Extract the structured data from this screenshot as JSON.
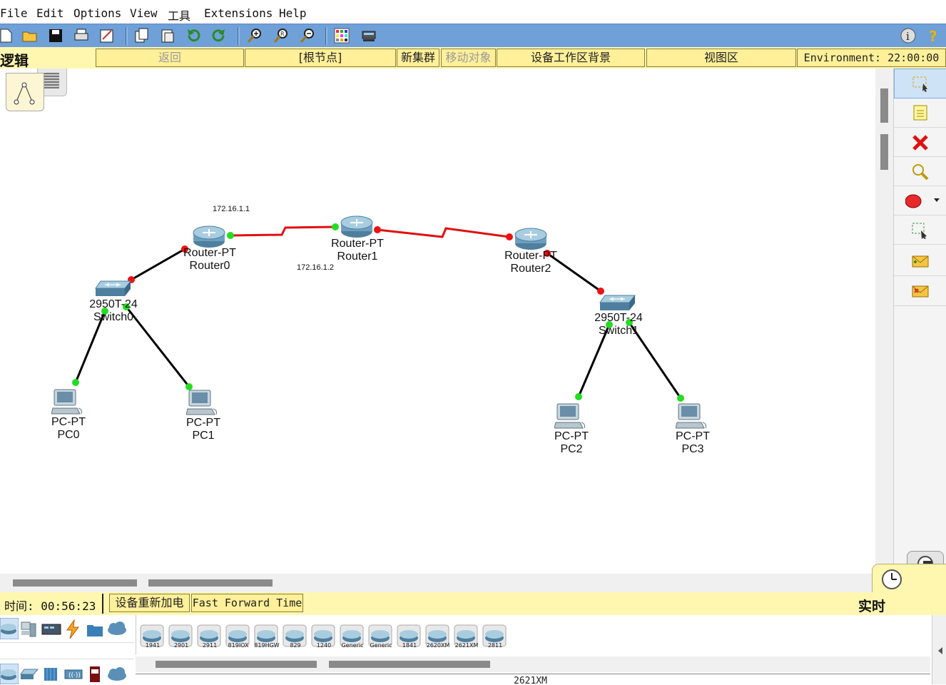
{
  "menu": [
    "File",
    "Edit",
    "Options",
    "View",
    "工具",
    "Extensions",
    "Help"
  ],
  "toolbar": {
    "icons": [
      "new-file-icon",
      "open-folder-icon",
      "save-icon",
      "print-icon",
      "activity-wizard-icon",
      "copy-icon",
      "paste-icon",
      "undo-icon",
      "redo-icon",
      "zoom-in-icon",
      "zoom-reset-icon",
      "zoom-out-icon",
      "palette-icon",
      "custom-device-icon",
      "info-icon",
      "help-icon"
    ]
  },
  "workspace_bar": {
    "mode_label": "逻辑",
    "back": "返回",
    "root": "[根节点]",
    "new_cluster": "新集群",
    "move_object": "移动对象",
    "background": "设备工作区背景",
    "viewport": "视图区",
    "environment": "Environment: 22:00:00"
  },
  "network": {
    "devices": [
      {
        "id": "router0",
        "type": "Router-PT",
        "name": "Router0"
      },
      {
        "id": "router1",
        "type": "Router-PT",
        "name": "Router1"
      },
      {
        "id": "router2",
        "type": "Router-PT",
        "name": "Router2"
      },
      {
        "id": "switch0",
        "type": "2950T-24",
        "name": "Switch0"
      },
      {
        "id": "switch1",
        "type": "2950T-24",
        "name": "Switch1"
      },
      {
        "id": "pc0",
        "type": "PC-PT",
        "name": "PC0"
      },
      {
        "id": "pc1",
        "type": "PC-PT",
        "name": "PC1"
      },
      {
        "id": "pc2",
        "type": "PC-PT",
        "name": "PC2"
      },
      {
        "id": "pc3",
        "type": "PC-PT",
        "name": "PC3"
      }
    ],
    "ip_labels": [
      "172.16.1.1",
      "172.16.1.2"
    ],
    "link_colors": {
      "serial": "#e01010",
      "ethernet": "#000000",
      "port_up": "#22dd22",
      "port_down": "#ee1111"
    }
  },
  "right_tools": [
    "select-icon",
    "note-icon",
    "delete-icon",
    "inspect-icon",
    "draw-shape-icon",
    "resize-icon",
    "simple-pdu-icon",
    "complex-pdu-icon"
  ],
  "status": {
    "time": "时间: 00:56:23",
    "power_cycle": "设备重新加电",
    "fast_forward": "Fast Forward Time",
    "realtime": "实时"
  },
  "device_models": [
    "1941",
    "2901",
    "2911",
    "819IOX",
    "819HGW",
    "829",
    "1240",
    "Generic",
    "Generic",
    "1841",
    "2620XM",
    "2621XM",
    "2811"
  ],
  "selected_model": "2621XM"
}
